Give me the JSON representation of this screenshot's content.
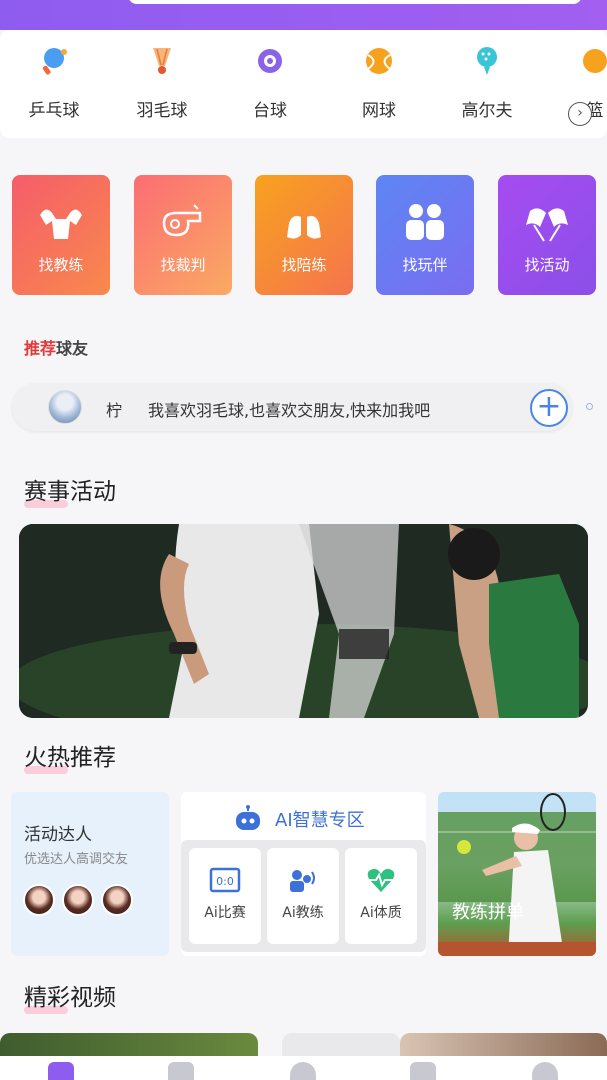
{
  "sports": [
    {
      "label": "乒乓球",
      "icon": "ping-pong-icon"
    },
    {
      "label": "羽毛球",
      "icon": "badminton-icon"
    },
    {
      "label": "台球",
      "icon": "billiards-icon"
    },
    {
      "label": "网球",
      "icon": "tennis-icon"
    },
    {
      "label": "高尔夫",
      "icon": "golf-icon"
    },
    {
      "label": "篮",
      "icon": "basketball-icon"
    }
  ],
  "find_cards": [
    {
      "label": "找教练",
      "icon": "muscle-icon"
    },
    {
      "label": "找裁判",
      "icon": "whistle-icon"
    },
    {
      "label": "找陪练",
      "icon": "lungs-icon"
    },
    {
      "label": "找玩伴",
      "icon": "people-icon"
    },
    {
      "label": "找活动",
      "icon": "flags-icon"
    }
  ],
  "recommend": {
    "title_a": "推荐",
    "title_b": "球友",
    "name": "柠",
    "message": "我喜欢羽毛球,也喜欢交朋友,快来加我吧"
  },
  "sections": {
    "events": "赛事活动",
    "hot": "火热推荐",
    "videos": "精彩视频"
  },
  "hot": {
    "talent_title": "活动达人",
    "talent_sub": "优选达人高调交友",
    "ai_title": "AI智慧专区",
    "ai_items": [
      "Ai比赛",
      "Ai教练",
      "Ai体质"
    ],
    "coach_group": "教练拼单"
  },
  "colors": {
    "accent": "#8f5cf0",
    "blue": "#3d71d9"
  }
}
